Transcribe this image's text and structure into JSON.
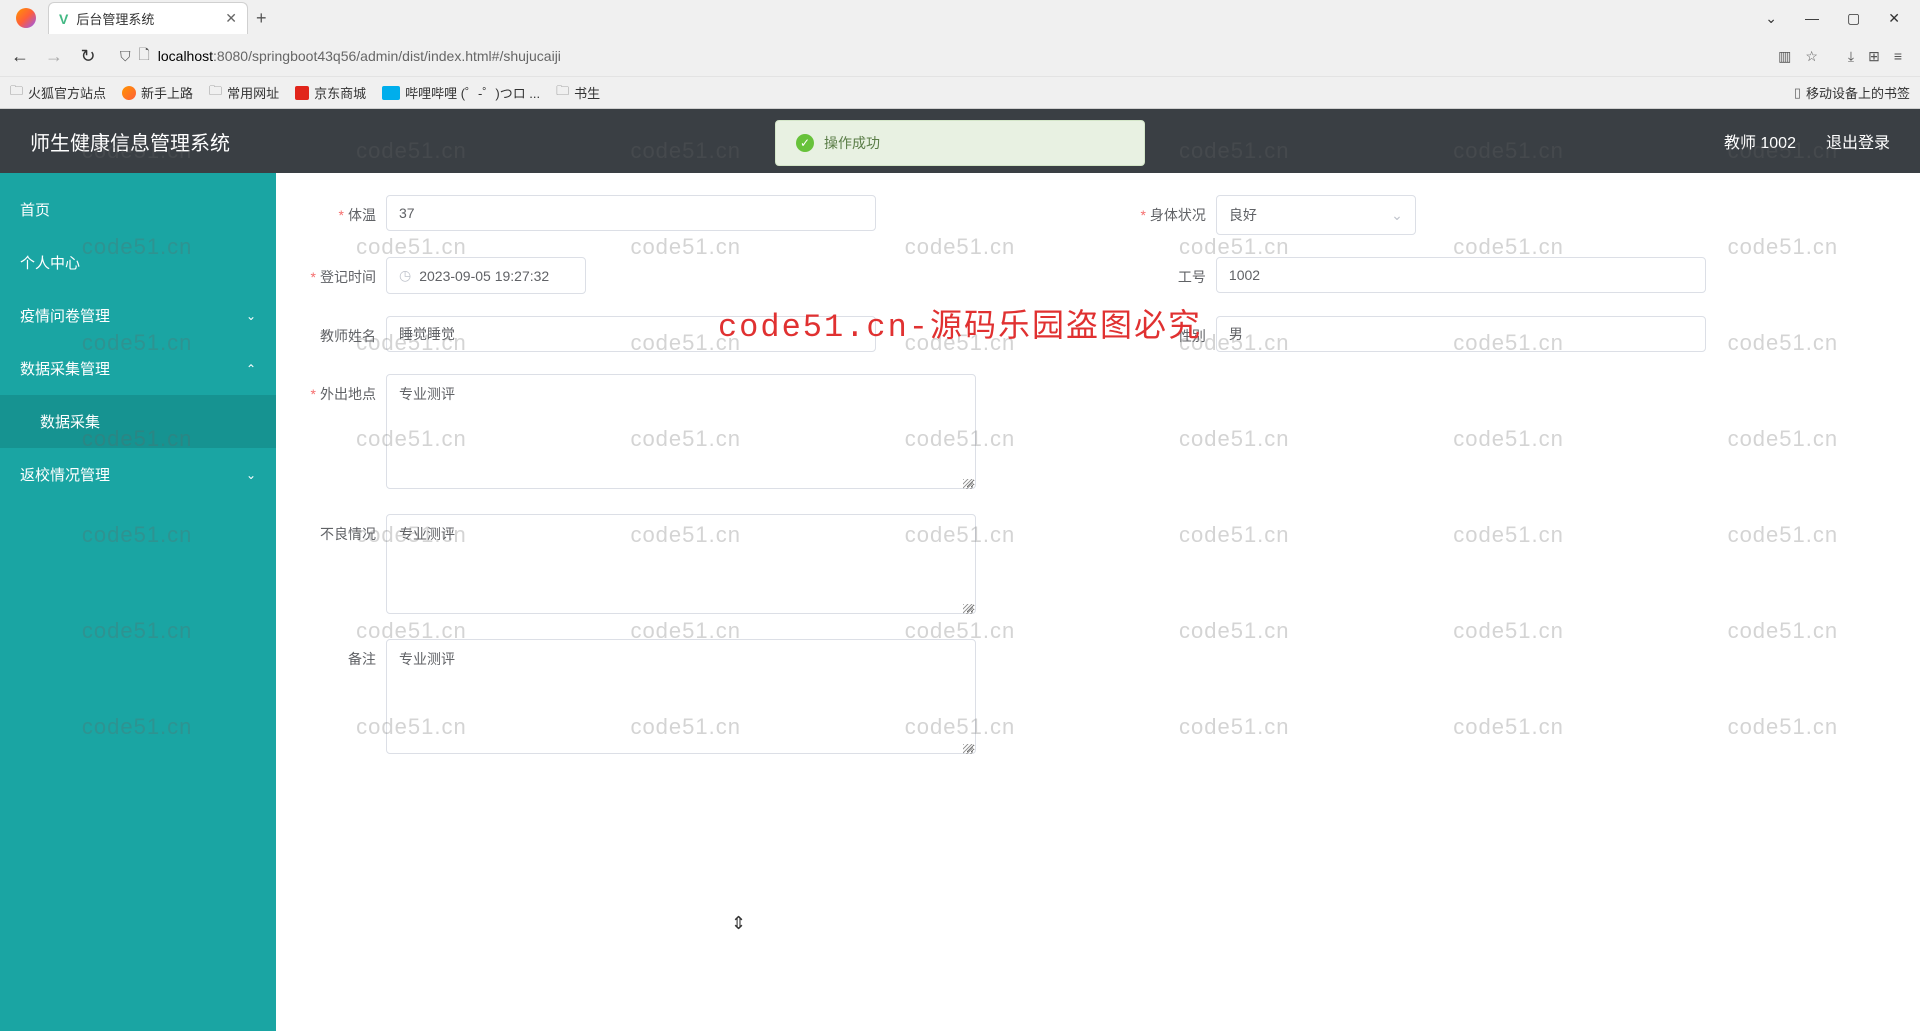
{
  "browser": {
    "tab_title": "后台管理系统",
    "url_host": "localhost",
    "url_path": ":8080/springboot43q56/admin/dist/index.html#/shujucaiji",
    "bookmarks": {
      "b1": "火狐官方站点",
      "b2": "新手上路",
      "b3": "常用网址",
      "b4": "京东商城",
      "b5": "哔哩哔哩 (゜-゜)つロ ...",
      "b6": "书生",
      "mobile": "移动设备上的书签"
    }
  },
  "header": {
    "title": "师生健康信息管理系统",
    "user": "教师 1002",
    "logout": "退出登录"
  },
  "toast": {
    "text": "操作成功"
  },
  "sidebar": {
    "home": "首页",
    "personal": "个人中心",
    "quest": "疫情问卷管理",
    "data_mgmt": "数据采集管理",
    "data_collect": "数据采集",
    "return_mgmt": "返校情况管理"
  },
  "form": {
    "labels": {
      "temp": "体温",
      "condition": "身体状况",
      "regtime": "登记时间",
      "empno": "工号",
      "tname": "教师姓名",
      "gender": "性别",
      "outplace": "外出地点",
      "bad": "不良情况",
      "remark": "备注"
    },
    "values": {
      "temp": "37",
      "condition": "良好",
      "regtime": "2023-09-05 19:27:32",
      "empno": "1002",
      "tname": "睡觉睡觉",
      "gender": "男",
      "outplace": "专业测评",
      "bad": "专业测评",
      "remark": "专业测评"
    }
  },
  "watermark": {
    "text": "code51.cn",
    "main": "code51.cn-源码乐园盗图必究"
  }
}
